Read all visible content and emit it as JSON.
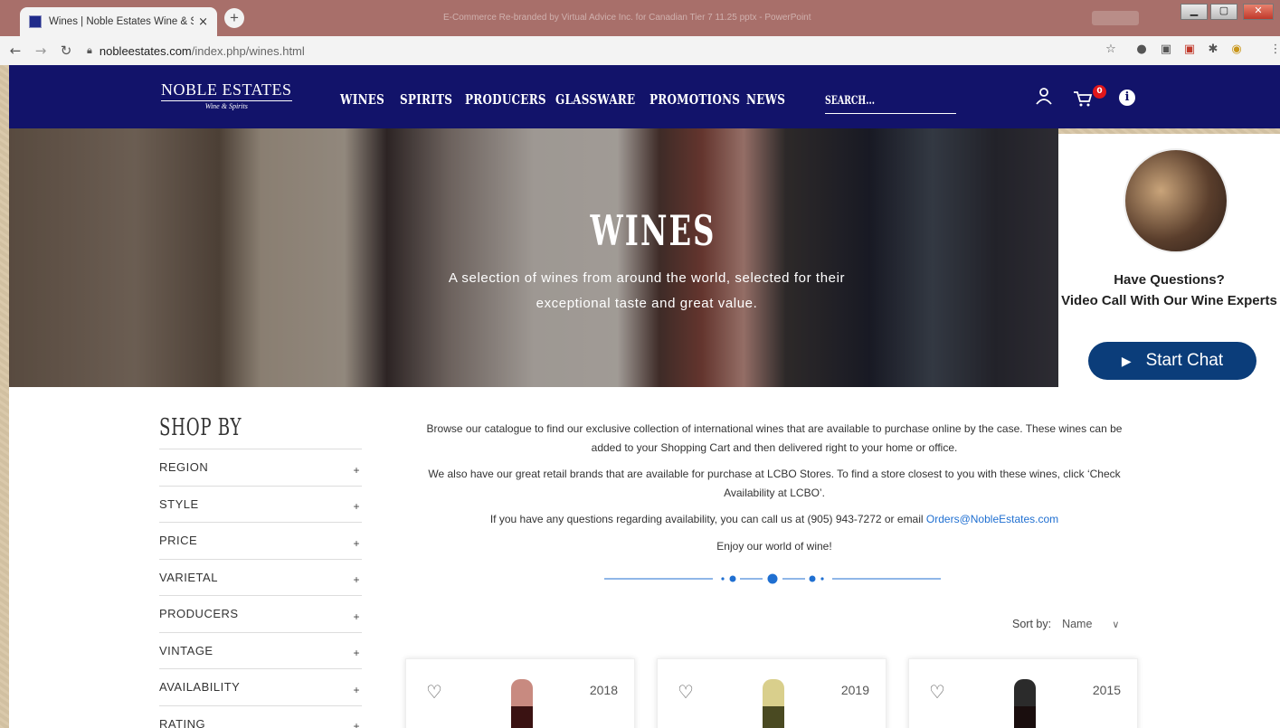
{
  "browser": {
    "tab_title": "Wines | Noble Estates Wine & Sp",
    "tab_close": "×",
    "new_tab": "+",
    "window_title": "E-Commerce Re-branded by Virtual Advice Inc. for Canadian Tier 7 11.25 pptx - PowerPoint",
    "url_domain": "nobleestates.com",
    "url_path": "/index.php/wines.html",
    "icons": [
      "back-icon",
      "forward-icon",
      "reload-icon",
      "lock-icon",
      "star-icon",
      "extension-icons",
      "menu-icon"
    ]
  },
  "header": {
    "logo_main": "NOBLE ESTATES",
    "logo_sub": "Wine & Spirits",
    "nav": [
      "WINES",
      "SPIRITS",
      "PRODUCERS",
      "GLASSWARE",
      "PROMOTIONS",
      "NEWS"
    ],
    "search_placeholder": "SEARCH...",
    "cart_count": "0",
    "info_label": "i",
    "colors": {
      "header_bg": "#12136a",
      "badge": "#e0161b"
    }
  },
  "hero": {
    "title": "WINES",
    "subtitle": "A selection of wines from around the world, selected for their exceptional taste and great value."
  },
  "chat": {
    "line1": "Have Questions?",
    "line2": "Video Call With Our Wine Experts",
    "button": "Start Chat",
    "button_color": "#0b3d7a"
  },
  "sidebar": {
    "title": "SHOP BY",
    "filters": [
      "REGION",
      "STYLE",
      "PRICE",
      "VARIETAL",
      "PRODUCERS",
      "VINTAGE",
      "AVAILABILITY",
      "RATING"
    ],
    "expand_symbol": "+"
  },
  "intro": {
    "p1": "Browse our catalogue to find our exclusive collection of international wines that are available to purchase online by the case. These wines can be added to your Shopping Cart and then delivered right to your home or office.",
    "p2": "We also have our great retail brands that are available for purchase at LCBO Stores. To find a store closest to you with these wines, click ‘Check Availability at LCBO’.",
    "p3_text": "If you have any questions regarding availability, you can call us at (905) 943-7272 or email ",
    "p3_link": "Orders@NobleEstates.com",
    "p4": "Enjoy our world of wine!"
  },
  "sort": {
    "label": "Sort by:",
    "value": "Name"
  },
  "products": [
    {
      "year": "2018",
      "cap_color": "#c88a80"
    },
    {
      "year": "2019",
      "cap_color": "#d9cf8c"
    },
    {
      "year": "2015",
      "cap_color": "#2b2b2b"
    }
  ]
}
